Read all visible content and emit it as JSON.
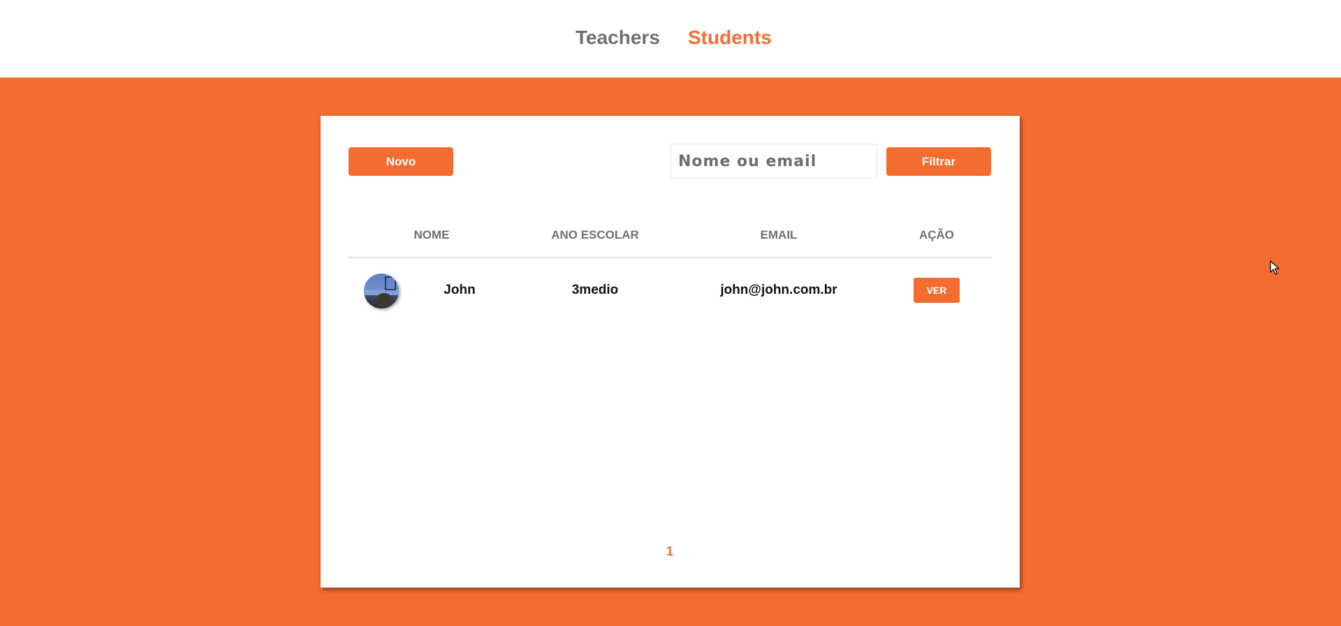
{
  "nav": {
    "teachers": "Teachers",
    "students": "Students",
    "active": "Students"
  },
  "toolbar": {
    "new_label": "Novo",
    "search_placeholder": "Nome ou email",
    "search_value": "",
    "filter_label": "Filtrar"
  },
  "table": {
    "headers": [
      "NOME",
      "ANO ESCOLAR",
      "EMAIL",
      "AÇÃO"
    ],
    "rows": [
      {
        "name": "John",
        "school_year": "3medio",
        "email": "john@john.com.br",
        "action": "VER"
      }
    ]
  },
  "pagination": {
    "current_page": "1"
  },
  "colors": {
    "accent": "#f46c30",
    "nav_inactive": "#707070",
    "header_text": "#6f6f6f"
  }
}
